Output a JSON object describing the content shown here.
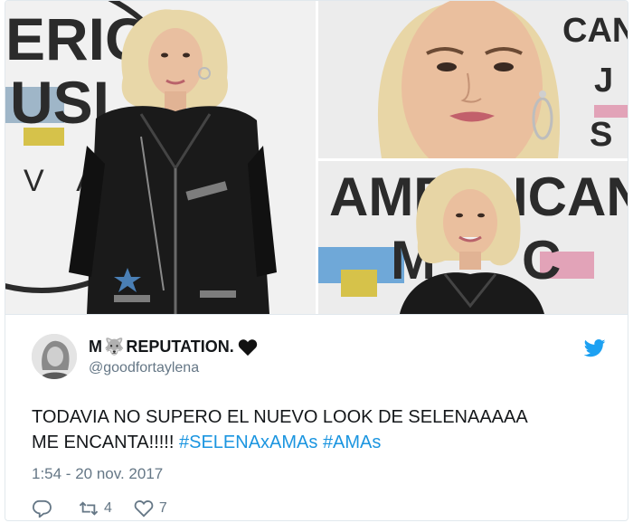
{
  "tweet": {
    "display_name_prefix": "M",
    "display_name_emoji": "🐺",
    "display_name_text": "REPUTATION.",
    "handle": "@goodfortaylena",
    "text_line1": "TODAVIA NO SUPERO EL NUEVO LOOK DE SELENAAAAA",
    "text_line2_plain": "ME ENCANTA!!!!! ",
    "hashtag1": "#SELENAxAMAs",
    "hashtag2": "#AMAs",
    "timestamp": "1:54 - 20 nov. 2017",
    "retweet_count": "4",
    "like_count": "7"
  },
  "photos": {
    "left_backdrop_text": "ERICA MUSIC AWA",
    "top_right_backdrop_text": "CAN S",
    "bottom_right_backdrop_top": "AMERICAN",
    "bottom_right_backdrop_bottom": "MUSIC"
  },
  "colors": {
    "hashtag": "#1b95e0",
    "secondary_text": "#657786",
    "twitter_blue": "#1da1f2"
  }
}
